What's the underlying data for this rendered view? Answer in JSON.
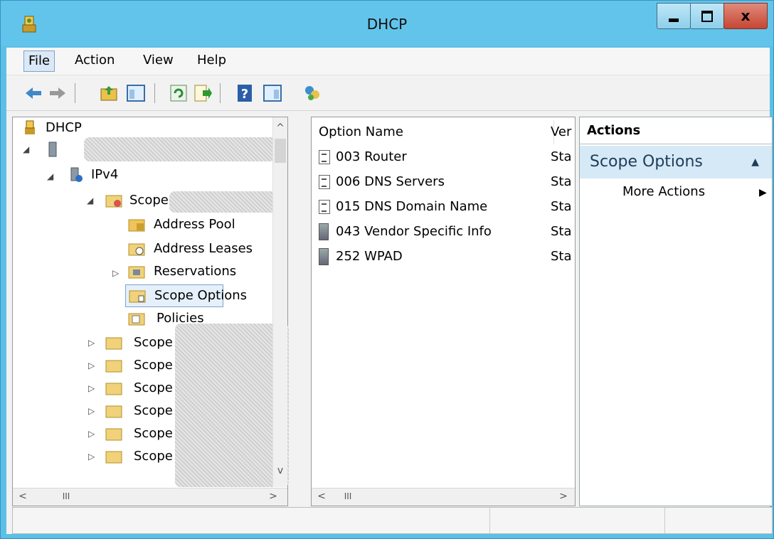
{
  "window": {
    "title": "DHCP"
  },
  "menu": [
    "File",
    "Action",
    "View",
    "Help"
  ],
  "tree": {
    "root": "DHCP",
    "ipv4": "IPv4",
    "scope_label": "Scope",
    "children": [
      "Address Pool",
      "Address Leases",
      "Reservations",
      "Scope Options",
      "Policies"
    ],
    "selected": "Scope Options"
  },
  "list": {
    "columns": [
      "Option Name",
      "Ver"
    ],
    "rows": [
      {
        "name": "003 Router",
        "vendor": "Sta",
        "icon": "option-icon"
      },
      {
        "name": "006 DNS Servers",
        "vendor": "Sta",
        "icon": "option-icon"
      },
      {
        "name": "015 DNS Domain Name",
        "vendor": "Sta",
        "icon": "option-icon"
      },
      {
        "name": "043 Vendor Specific Info",
        "vendor": "Sta",
        "icon": "server-option-icon"
      },
      {
        "name": "252 WPAD",
        "vendor": "Sta",
        "icon": "server-option-icon"
      }
    ]
  },
  "actions": {
    "header": "Actions",
    "group": "Scope Options",
    "items": [
      "More Actions"
    ]
  },
  "scroll_glyphs": {
    "left": "<",
    "right": ">",
    "thumb": "III",
    "up": "^",
    "down": "v"
  }
}
